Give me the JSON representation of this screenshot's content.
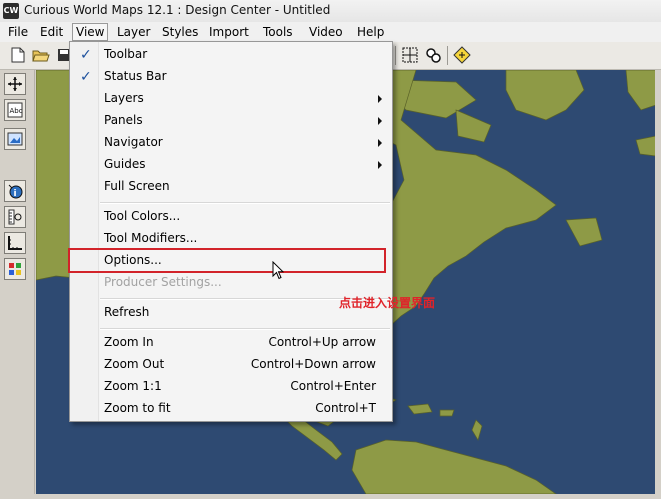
{
  "window": {
    "title": "Curious World Maps 12.1  : Design Center - Untitled",
    "app_icon_text": "CW"
  },
  "menubar": [
    "File",
    "Edit",
    "View",
    "Layer",
    "Styles",
    "Import",
    "Tools",
    "Video",
    "Help"
  ],
  "active_menu": "View",
  "view_menu": {
    "items": [
      {
        "label": "Toolbar",
        "checked": true
      },
      {
        "label": "Status Bar",
        "checked": true
      },
      {
        "label": "Layers",
        "submenu": true
      },
      {
        "label": "Panels",
        "submenu": true
      },
      {
        "label": "Navigator",
        "submenu": true
      },
      {
        "label": "Guides",
        "submenu": true
      },
      {
        "label": "Full Screen"
      },
      {
        "label": "Tool Colors..."
      },
      {
        "label": "Tool Modifiers..."
      },
      {
        "label": "Options..."
      },
      {
        "label": "Producer Settings...",
        "disabled": true
      },
      {
        "label": "Refresh"
      },
      {
        "label": "Zoom In",
        "shortcut": "Control+Up arrow"
      },
      {
        "label": "Zoom Out",
        "shortcut": "Control+Down arrow"
      },
      {
        "label": "Zoom 1:1",
        "shortcut": "Control+Enter"
      },
      {
        "label": "Zoom to fit",
        "shortcut": "Control+T"
      }
    ]
  },
  "annotation": "点击进入设置界面",
  "colors": {
    "ocean": "#2e4a72",
    "land": "#8e9a46",
    "highlight": "#d2232a"
  }
}
